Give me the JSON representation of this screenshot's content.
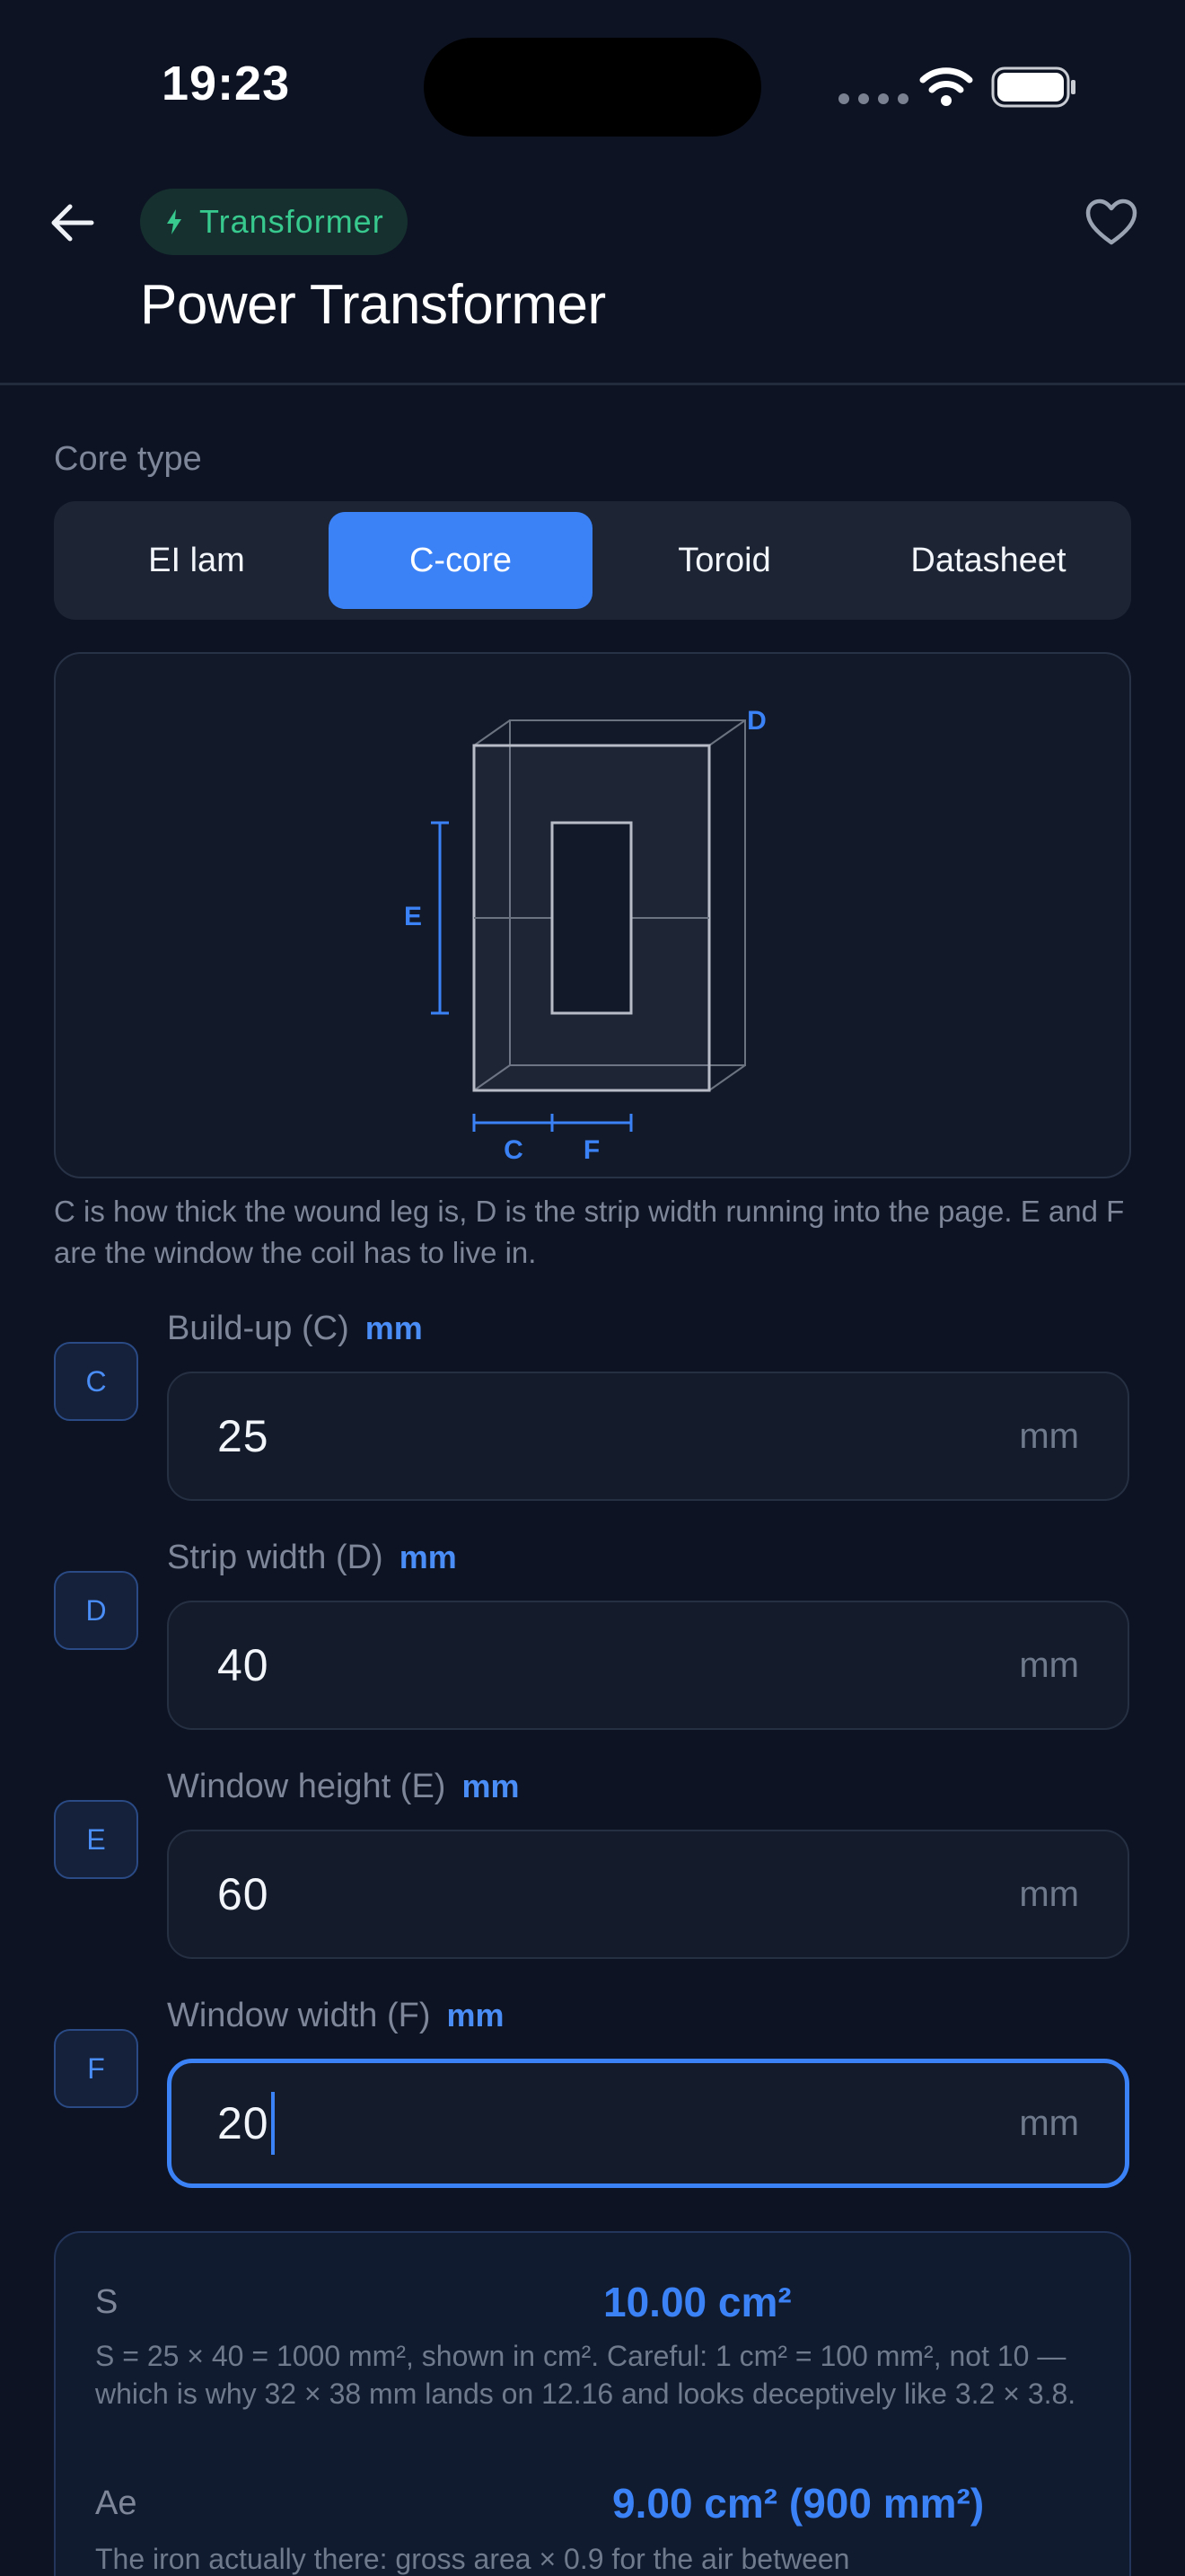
{
  "status_bar": {
    "time": "19:23"
  },
  "header": {
    "badge": "Transformer",
    "title": "Power Transformer"
  },
  "core_type": {
    "label": "Core type",
    "options": [
      "EI lam",
      "C-core",
      "Toroid",
      "Datasheet"
    ],
    "selected": "C-core"
  },
  "diagram": {
    "labels": {
      "c": "C",
      "d": "D",
      "e": "E",
      "f": "F"
    },
    "note": "C is how thick the wound leg is, D is the strip width running into the page. E and F are the window the coil has to live in."
  },
  "fields": [
    {
      "tag": "C",
      "label": "Build-up (C)",
      "unit": "mm",
      "value": "25",
      "suffix": "mm"
    },
    {
      "tag": "D",
      "label": "Strip width (D)",
      "unit": "mm",
      "value": "40",
      "suffix": "mm"
    },
    {
      "tag": "E",
      "label": "Window height (E)",
      "unit": "mm",
      "value": "60",
      "suffix": "mm"
    },
    {
      "tag": "F",
      "label": "Window width (F)",
      "unit": "mm",
      "value": "20",
      "suffix": "mm"
    }
  ],
  "results": [
    {
      "name": "S",
      "value": "10.00 cm²",
      "description": "S = 25 × 40 = 1000 mm², shown in cm². Careful: 1 cm² = 100 mm², not 10 — which is why 32 × 38 mm lands on 12.16 and looks deceptively like 3.2 × 3.8."
    },
    {
      "name": "Ae",
      "value": "9.00 cm²  (900 mm²)",
      "description": "The iron actually there: gross area × 0.9 for the air between"
    }
  ],
  "colors": {
    "background": "#0d1322",
    "accent": "#3b82f6",
    "badge_green": "#37c98d"
  }
}
